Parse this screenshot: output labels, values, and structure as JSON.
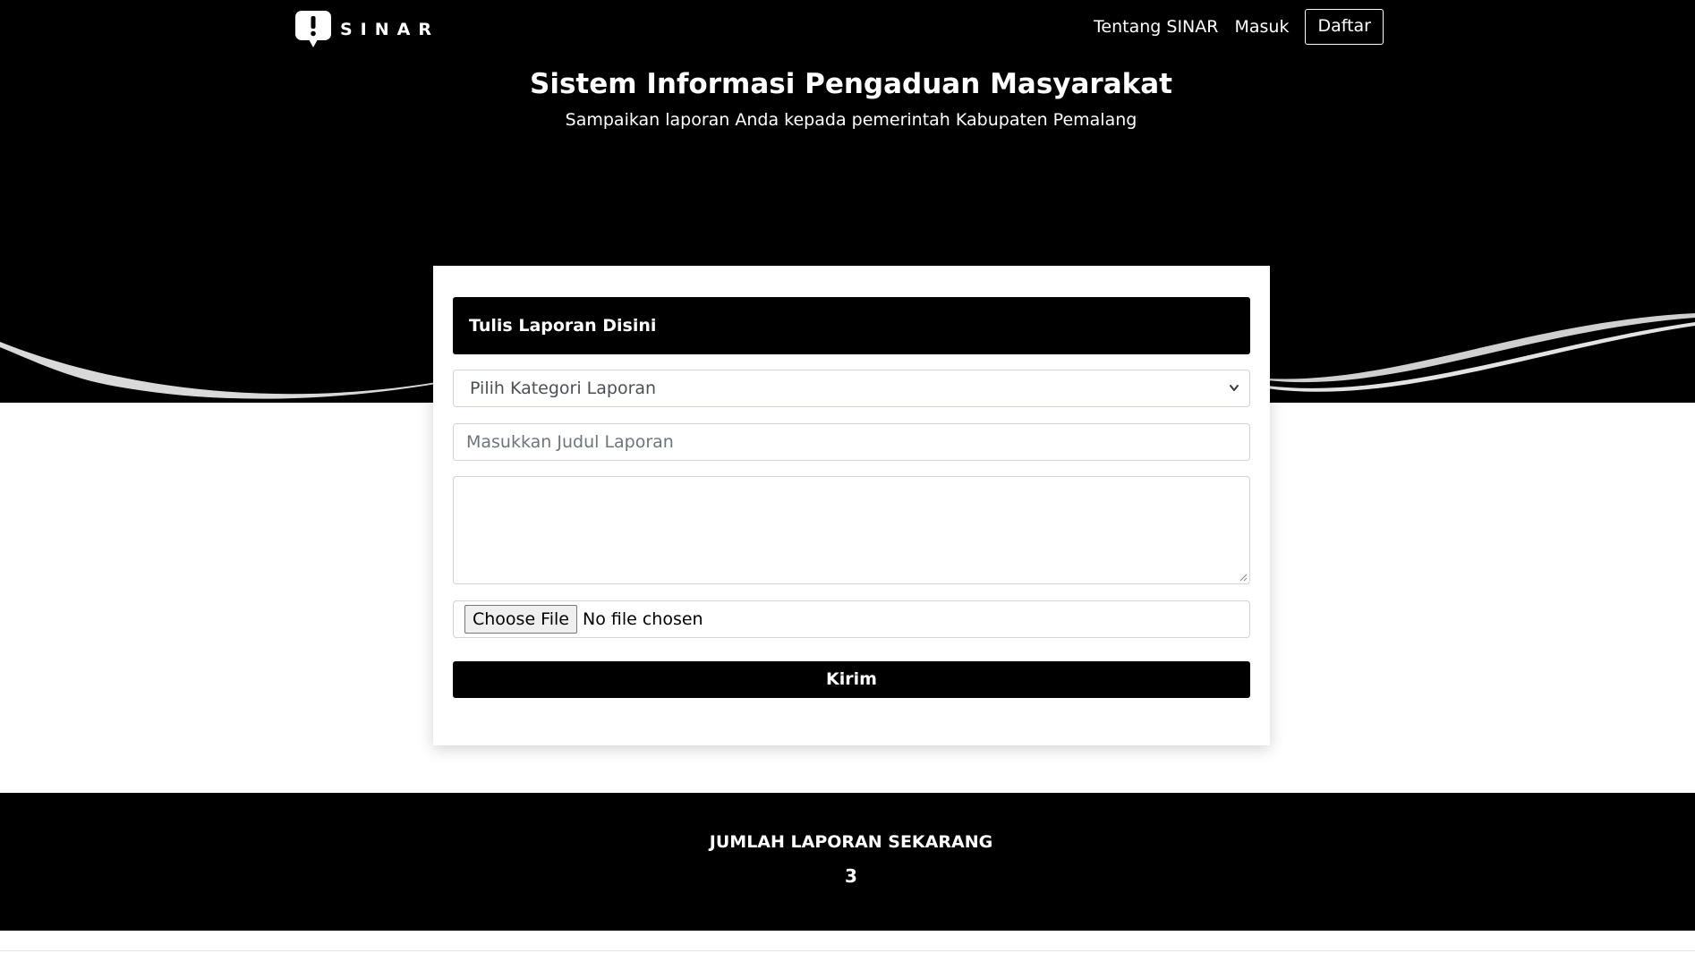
{
  "brand": {
    "name": "SINAR",
    "icon": "exclamation-chat-bubble-icon"
  },
  "nav": {
    "about": "Tentang SINAR",
    "login": "Masuk",
    "register": "Daftar"
  },
  "hero": {
    "title": "Sistem Informasi Pengaduan Masyarakat",
    "subtitle": "Sampaikan laporan Anda kepada pemerintah Kabupaten Pemalang"
  },
  "form": {
    "header": "Tulis Laporan Disini",
    "category_select": "Pilih Kategori Laporan",
    "title_placeholder": "Masukkan Judul Laporan",
    "body_value": "",
    "file_button": "Choose File",
    "file_status": "No file chosen",
    "submit_label": "Kirim"
  },
  "stats": {
    "label": "JUMLAH LAPORAN SEKARANG",
    "value": "3"
  },
  "colors": {
    "primary": "#000000",
    "background": "#ffffff",
    "border": "#cfd4da",
    "wave_gray": "#d9d9d9"
  }
}
